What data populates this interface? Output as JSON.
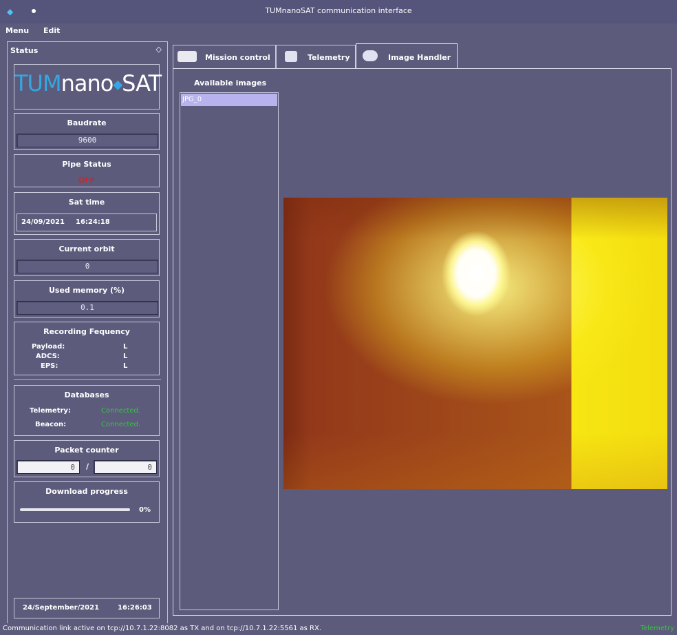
{
  "window": {
    "title": "TUMnanoSAT communication interface"
  },
  "menu": {
    "items": [
      "Menu",
      "Edit"
    ]
  },
  "status_panel": {
    "title": "Status",
    "logo": {
      "tum": "TUM",
      "nano": "nano",
      "sat": "SAT"
    },
    "baudrate": {
      "label": "Baudrate",
      "value": "9600"
    },
    "pipe_status": {
      "label": "Pipe Status",
      "value": "OFF"
    },
    "sat_time": {
      "label": "Sat time",
      "date": "24/09/2021",
      "time": "16:24:18"
    },
    "current_orbit": {
      "label": "Current orbit",
      "value": "0"
    },
    "used_memory": {
      "label": "Used memory (%)",
      "value": "0.1"
    },
    "recording_frequency": {
      "label": "Recording Fequency",
      "rows": [
        {
          "name": "Payload:",
          "value": "L"
        },
        {
          "name": "ADCS:",
          "value": "L"
        },
        {
          "name": "EPS:",
          "value": "L"
        }
      ]
    },
    "databases": {
      "label": "Databases",
      "rows": [
        {
          "name": "Telemetry:",
          "value": "Connected."
        },
        {
          "name": "Beacon:",
          "value": "Connected."
        }
      ]
    },
    "packet_counter": {
      "label": "Packet counter",
      "left": "0",
      "separator": "/",
      "right": "0"
    },
    "download_progress": {
      "label": "Download progress",
      "value": "0%"
    },
    "footer_date": "24/September/2021",
    "footer_time": "16:26:03"
  },
  "tabs": [
    {
      "label": "Mission control",
      "active": false
    },
    {
      "label": "Telemetry",
      "active": false
    },
    {
      "label": "Image Handler",
      "active": true
    }
  ],
  "image_handler": {
    "available_label": "Available images",
    "images": [
      "JPG_0"
    ]
  },
  "statusbar": {
    "message": "Communication link active on tcp://10.7.1.22:8082 as TX and on tcp://10.7.1.22:5561 as RX.",
    "right": "Telemetry"
  },
  "colors": {
    "background": "#5c5b7c",
    "connected": "#35c63c",
    "off": "#e01f1f",
    "selection": "#b8b2ee",
    "logo_blue": "#35a7e0"
  }
}
